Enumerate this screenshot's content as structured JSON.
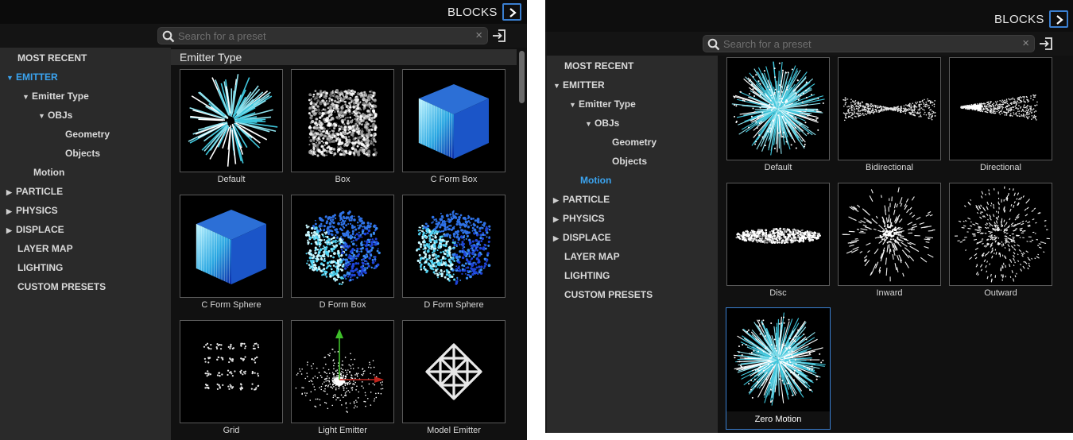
{
  "left_panel": {
    "header": {
      "title": "BLOCKS"
    },
    "search": {
      "placeholder": "Search for a preset"
    },
    "tree": [
      {
        "label": "MOST RECENT",
        "arrow": ""
      },
      {
        "label": "EMITTER",
        "arrow": "▼"
      },
      {
        "label": "Emitter Type",
        "arrow": "▼"
      },
      {
        "label": "OBJs",
        "arrow": "▼"
      },
      {
        "label": "Geometry",
        "arrow": ""
      },
      {
        "label": "Objects",
        "arrow": ""
      },
      {
        "label": "Motion",
        "arrow": ""
      },
      {
        "label": "PARTICLE",
        "arrow": "▶"
      },
      {
        "label": "PHYSICS",
        "arrow": "▶"
      },
      {
        "label": "DISPLACE",
        "arrow": "▶"
      },
      {
        "label": "LAYER MAP",
        "arrow": ""
      },
      {
        "label": "LIGHTING",
        "arrow": ""
      },
      {
        "label": "CUSTOM PRESETS",
        "arrow": ""
      }
    ],
    "section_title": "Emitter Type",
    "presets": [
      "Default",
      "Box",
      "C Form Box",
      "C Form Sphere",
      "D Form Box",
      "D Form Sphere",
      "Grid",
      "Light Emitter",
      "Model Emitter"
    ]
  },
  "right_panel": {
    "header": {
      "title": "BLOCKS"
    },
    "search": {
      "placeholder": "Search for a preset"
    },
    "tree": [
      {
        "label": "MOST RECENT",
        "arrow": ""
      },
      {
        "label": "EMITTER",
        "arrow": "▼"
      },
      {
        "label": "Emitter Type",
        "arrow": "▼"
      },
      {
        "label": "OBJs",
        "arrow": "▼"
      },
      {
        "label": "Geometry",
        "arrow": ""
      },
      {
        "label": "Objects",
        "arrow": ""
      },
      {
        "label": "Motion",
        "arrow": ""
      },
      {
        "label": "PARTICLE",
        "arrow": "▶"
      },
      {
        "label": "PHYSICS",
        "arrow": "▶"
      },
      {
        "label": "DISPLACE",
        "arrow": "▶"
      },
      {
        "label": "LAYER MAP",
        "arrow": ""
      },
      {
        "label": "LIGHTING",
        "arrow": ""
      },
      {
        "label": "CUSTOM PRESETS",
        "arrow": ""
      }
    ],
    "presets": [
      "Default",
      "Bidirectional",
      "Directional",
      "Disc",
      "Inward",
      "Outward",
      "Zero Motion"
    ],
    "selected_preset": "Zero Motion"
  },
  "colors": {
    "accent_blue": "#3ba4f0",
    "panel_bg": "#1c1c1c",
    "tree_bg": "#2a2a2a",
    "thumb_bg": "#000000"
  },
  "icons": {
    "toggle": "chevron-right-icon",
    "search": "search-icon",
    "clear": "close-icon",
    "import": "import-icon"
  }
}
